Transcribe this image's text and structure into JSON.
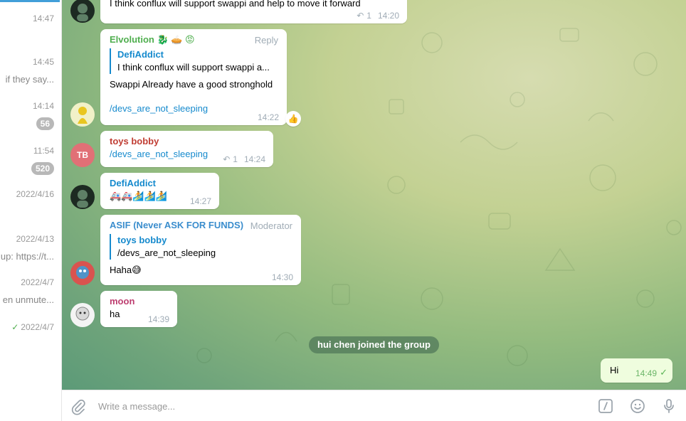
{
  "sidebar": {
    "rows": [
      {
        "time": "14:47",
        "preview": "",
        "badge": ""
      },
      {
        "time": "14:45",
        "preview": "if they say...",
        "badge": ""
      },
      {
        "time": "14:14",
        "preview": "",
        "badge": "56"
      },
      {
        "time": "11:54",
        "preview": "",
        "badge": "520"
      },
      {
        "time": "2022/4/16",
        "preview": "",
        "badge": ""
      },
      {
        "time": "2022/4/13",
        "preview": "up: https://t...",
        "badge": ""
      },
      {
        "time": "2022/4/7",
        "preview": "en unmute...",
        "badge": ""
      },
      {
        "time": "2022/4/7",
        "preview": "",
        "badge": "",
        "check": "✓"
      }
    ]
  },
  "messages": {
    "m0": {
      "text": "I think conflux will support swappi and help to move it forward",
      "replies": "1",
      "time": "14:20"
    },
    "m1": {
      "sender": "Elvolution 🐉 🥧 😡",
      "reply_label": "Reply",
      "quote_name": "DefiAddict",
      "quote_text": "I think conflux will support swappi a...",
      "text": "Swappi Already have a good stronghold",
      "link": "/devs_are_not_sleeping",
      "time": "14:22",
      "reaction": "👍"
    },
    "m2": {
      "avatar_initials": "TB",
      "sender": "toys bobby",
      "link": "/devs_are_not_sleeping",
      "replies": "1",
      "time": "14:24"
    },
    "m3": {
      "sender": "DefiAddict",
      "text": "🚑🚑🏄🏄🏄",
      "time": "14:27"
    },
    "m4": {
      "sender": "ASIF (Never ASK FOR FUNDS)",
      "role": "Moderator",
      "quote_name": "toys bobby",
      "quote_text": "/devs_are_not_sleeping",
      "text": "Haha😅",
      "time": "14:30"
    },
    "m5": {
      "sender": "moon",
      "text": "ha",
      "time": "14:39"
    }
  },
  "service_message": "hui chen joined the group",
  "outgoing": {
    "text": "Hi",
    "time": "14:49",
    "tick": "✓"
  },
  "composer": {
    "placeholder": "Write a message..."
  },
  "colors": {
    "elvolution": "#4fae4e",
    "toys_bobby": "#c03d33",
    "defiaddict": "#168acd",
    "asif": "#3a8dcd",
    "moon": "#bd3d6f",
    "tb_avatar": "#e17076"
  }
}
